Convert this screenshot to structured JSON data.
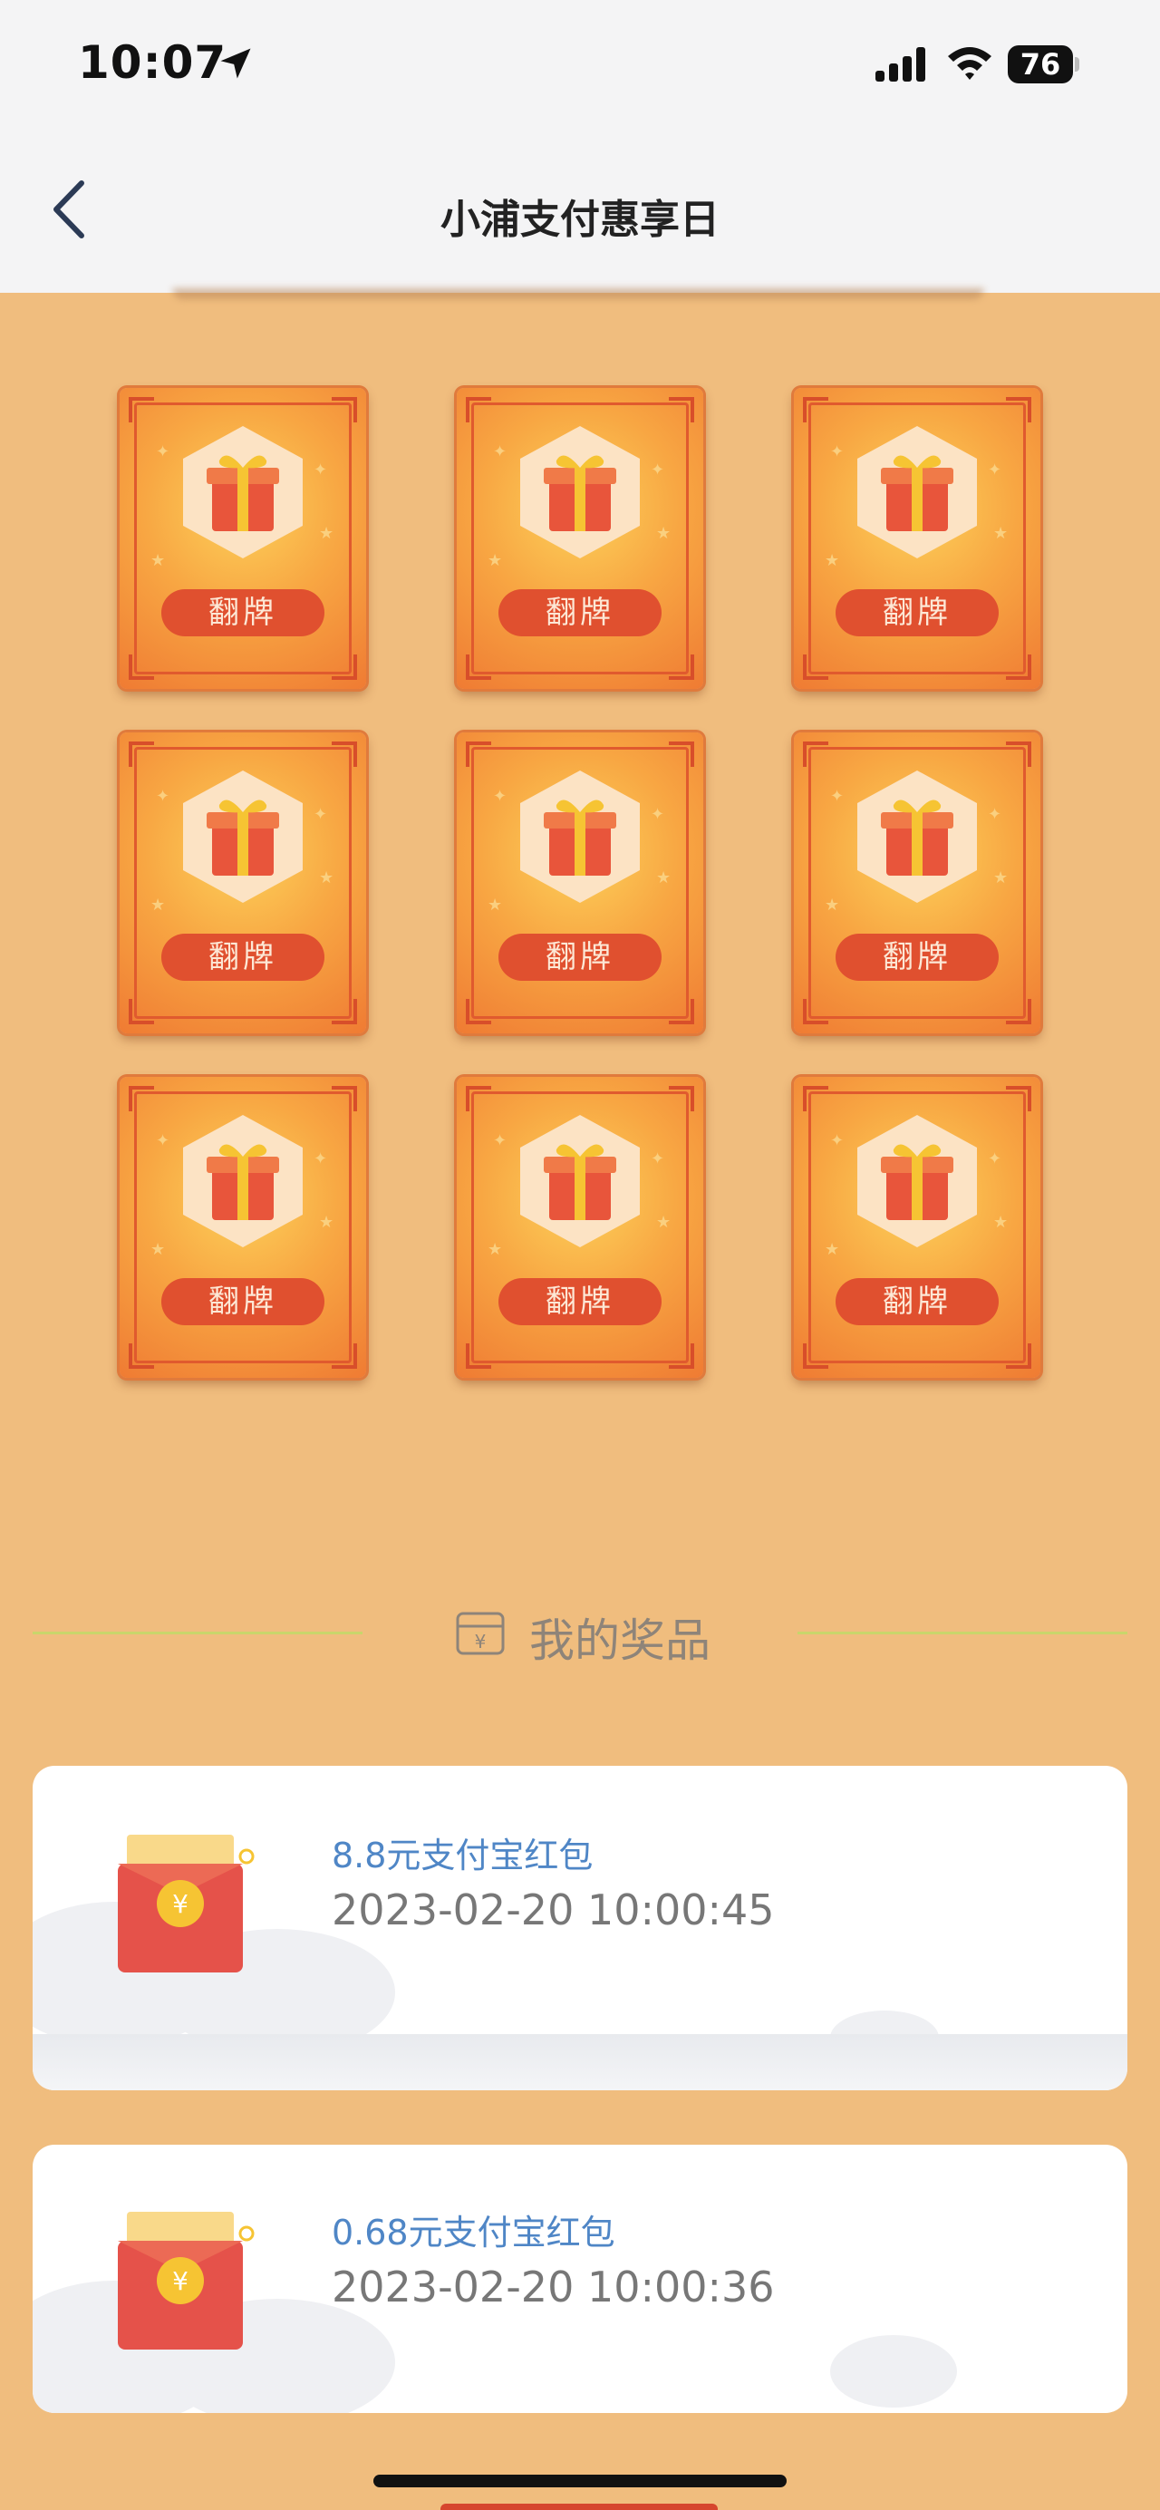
{
  "status_bar": {
    "time": "10:07",
    "battery": "76"
  },
  "nav": {
    "title": "小浦支付惠享日"
  },
  "cards": [
    {
      "label": "翻牌"
    },
    {
      "label": "翻牌"
    },
    {
      "label": "翻牌"
    },
    {
      "label": "翻牌"
    },
    {
      "label": "翻牌"
    },
    {
      "label": "翻牌"
    },
    {
      "label": "翻牌"
    },
    {
      "label": "翻牌"
    },
    {
      "label": "翻牌"
    }
  ],
  "prizes": {
    "title": "我的奖品",
    "items": [
      {
        "name": "8.8元支付宝红包",
        "time": "2023-02-20 10:00:45"
      },
      {
        "name": "0.68元支付宝红包",
        "time": "2023-02-20 10:00:36"
      }
    ]
  },
  "colors": {
    "background": "#F0BD7E",
    "card_orange": "#EF7B33",
    "flip_button": "#E0502F",
    "prize_name": "#4F86C6"
  }
}
